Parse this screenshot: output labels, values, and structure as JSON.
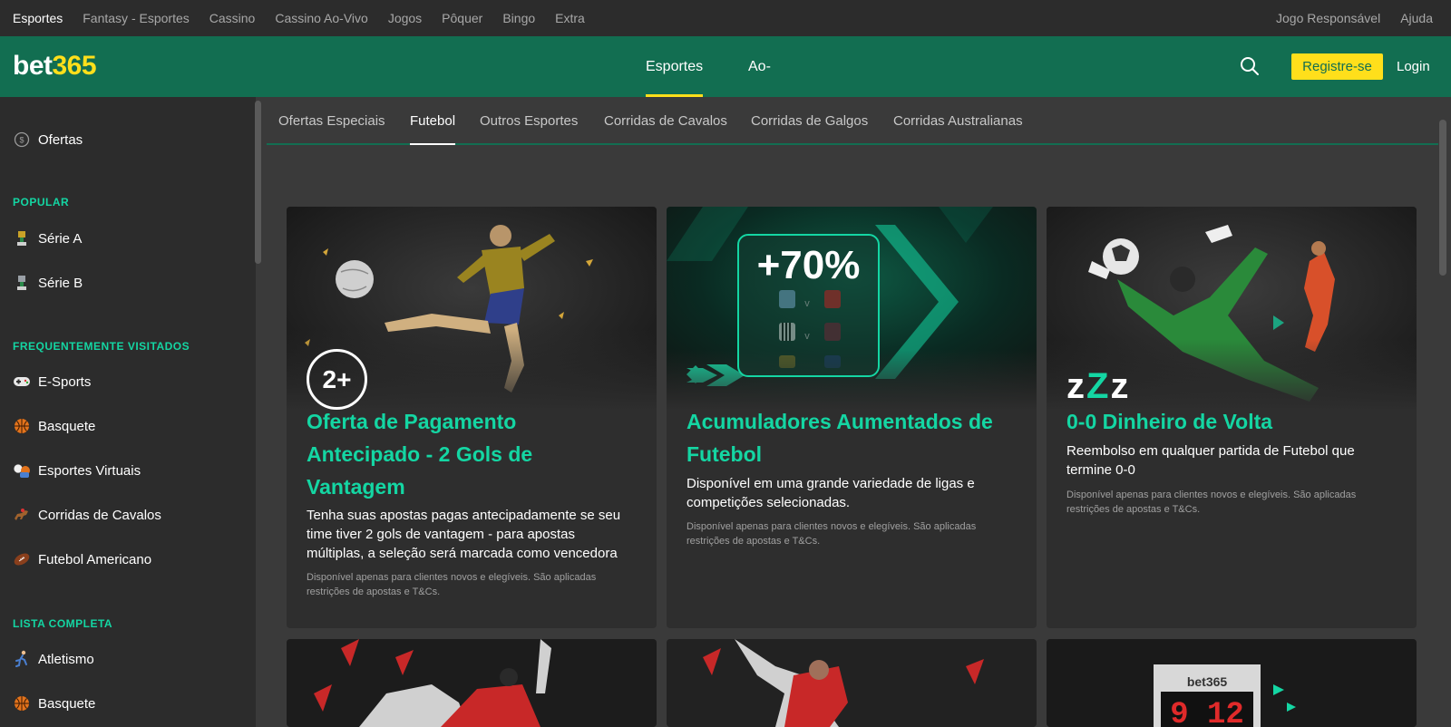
{
  "topbar": {
    "nav": [
      "Esportes",
      "Fantasy - Esportes",
      "Cassino",
      "Cassino Ao-Vivo",
      "Jogos",
      "Pôquer",
      "Bingo",
      "Extra"
    ],
    "right": [
      "Jogo Responsável",
      "Ajuda"
    ]
  },
  "header": {
    "logo_a": "bet",
    "logo_b": "365",
    "nav": [
      "Esportes",
      "Ao-Vivo"
    ],
    "register": "Registre-se",
    "login": "Login"
  },
  "sidebar": {
    "offers": "Ofertas",
    "popular_heading": "POPULAR",
    "popular": [
      "Série A",
      "Série B"
    ],
    "frequent_heading": "FREQUENTEMENTE VISITADOS",
    "frequent": [
      "E-Sports",
      "Basquete",
      "Esportes Virtuais",
      "Corridas de Cavalos",
      "Futebol Americano"
    ],
    "full_heading": "LISTA COMPLETA",
    "full": [
      "Atletismo",
      "Basquete"
    ]
  },
  "subtabs": [
    "Ofertas Especiais",
    "Futebol",
    "Outros Esportes",
    "Corridas de Cavalos",
    "Corridas de Galgos",
    "Corridas Australianas"
  ],
  "cards": [
    {
      "badge": "2+",
      "title_lines": [
        "Oferta de Pagamento",
        "Antecipado - 2 Gols de",
        "Vantagem"
      ],
      "desc_lines": [
        "Tenha suas apostas pagas antecipadamente se seu",
        "time tiver 2 gols de vantagem - para apostas",
        "múltiplas, a seleção será marcada como vencedora"
      ],
      "fine_lines": [
        "Disponível apenas para clientes novos e elegíveis. São aplicadas",
        "restrições de apostas e T&Cs."
      ]
    },
    {
      "badge": "+70%",
      "title_lines": [
        "Acumuladores Aumentados de",
        "Futebol"
      ],
      "desc_lines": [
        "Disponível em uma grande variedade de ligas e",
        "competições selecionadas."
      ],
      "fine_lines": [
        "Disponível apenas para clientes novos e elegíveis. São aplicadas",
        "restrições de apostas e T&Cs."
      ]
    },
    {
      "badge_a": "z",
      "badge_b": "Z",
      "badge_c": "z",
      "title_lines": [
        "0-0 Dinheiro de Volta"
      ],
      "desc_lines": [
        "Reembolso em qualquer partida de Futebol que",
        "termine 0-0"
      ],
      "fine_lines": [
        "Disponível apenas para clientes novos e elegíveis. São aplicadas",
        "restrições de apostas e T&Cs."
      ]
    }
  ],
  "bottom_cards": [
    {
      "scoreboard_brand": "bet365",
      "scoreboard_digits": "9 12"
    }
  ],
  "colors": {
    "brand_green": "#126e51",
    "accent_yellow": "#ffdf1b",
    "accent_teal": "#14d6a3"
  }
}
